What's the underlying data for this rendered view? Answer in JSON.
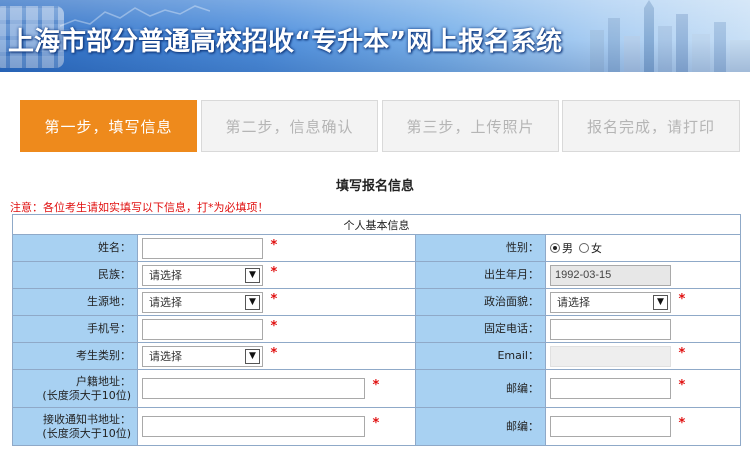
{
  "banner": {
    "title": "上海市部分普通高校招收“专升本”网上报名系统"
  },
  "steps": [
    {
      "label": "第一步，填写信息",
      "active": true
    },
    {
      "label": "第二步，信息确认",
      "active": false
    },
    {
      "label": "第三步，上传照片",
      "active": false
    },
    {
      "label": "报名完成，请打印",
      "active": false
    }
  ],
  "form": {
    "title": "填写报名信息",
    "notice": "注意：各位考生请如实填写以下信息，打*为必填项！",
    "section": "个人基本信息",
    "required_mark": "*",
    "fields": {
      "name": {
        "label": "姓名：",
        "value": ""
      },
      "gender": {
        "label": "性别：",
        "option_male": "男",
        "option_female": "女",
        "selected": "男"
      },
      "ethnicity": {
        "label": "民族：",
        "selected": "请选择"
      },
      "birth": {
        "label": "出生年月：",
        "value": "1992-03-15"
      },
      "origin": {
        "label": "生源地：",
        "selected": "请选择"
      },
      "political": {
        "label": "政治面貌：",
        "selected": "请选择"
      },
      "mobile": {
        "label": "手机号：",
        "value": ""
      },
      "phone": {
        "label": "固定电话：",
        "value": ""
      },
      "category": {
        "label": "考生类别：",
        "selected": "请选择"
      },
      "email": {
        "label": "Email：",
        "value": ""
      },
      "household_address": {
        "label_line1": "户籍地址：",
        "label_line2": "(长度须大于10位)",
        "value": ""
      },
      "postcode1": {
        "label": "邮编：",
        "value": ""
      },
      "mail_address": {
        "label_line1": "接收通知书地址：",
        "label_line2": "(长度须大于10位)",
        "value": ""
      },
      "postcode2": {
        "label": "邮编：",
        "value": ""
      }
    }
  }
}
